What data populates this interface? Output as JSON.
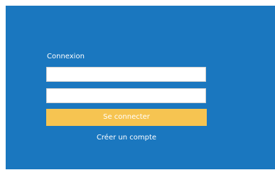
{
  "colors": {
    "panel_background": "#1a77bf",
    "button_background": "#f6c451",
    "text": "#ffffff",
    "page_background": "#ffffff"
  },
  "login": {
    "heading": "Connexion",
    "username_value": "",
    "password_value": "",
    "submit_label": "Se connecter",
    "create_account_label": "Créer un compte"
  }
}
